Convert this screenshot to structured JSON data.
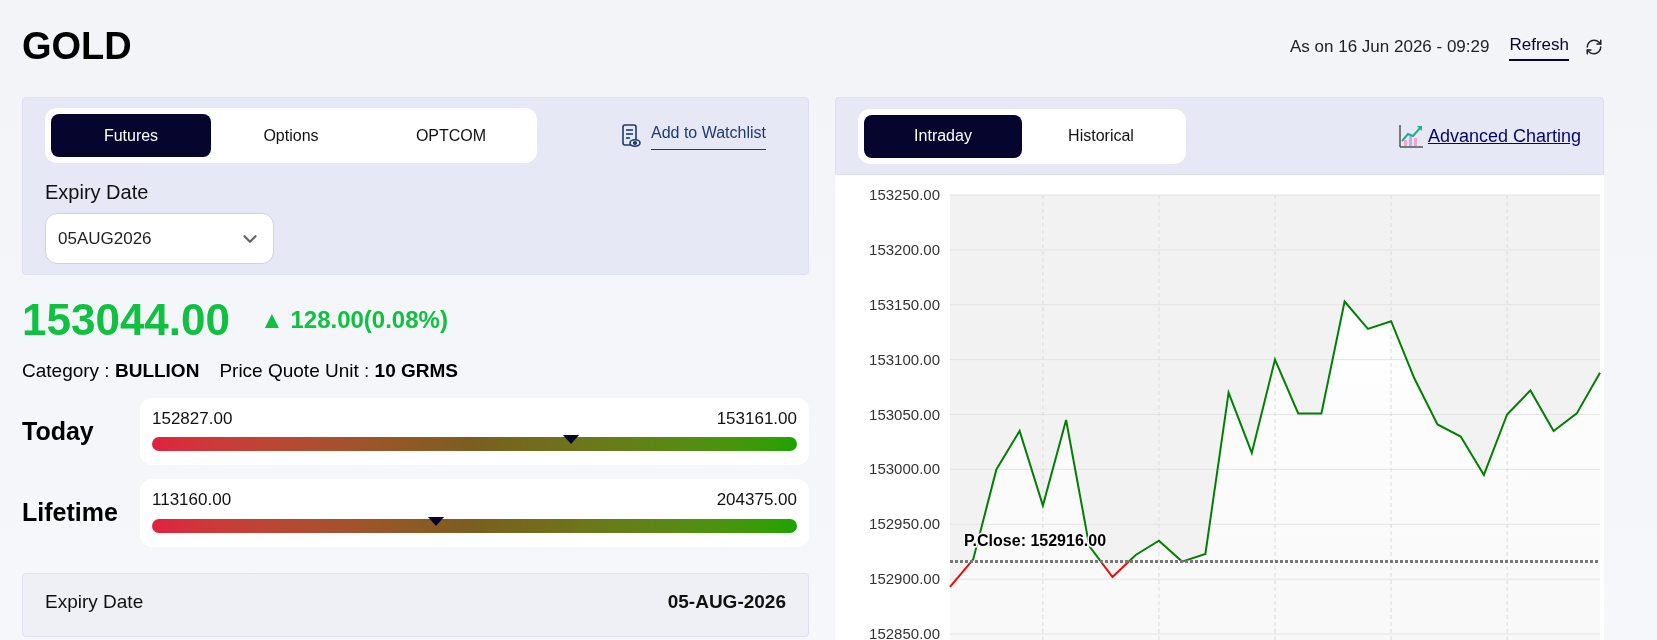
{
  "title": "GOLD",
  "header": {
    "as_on": "As on 16 Jun 2026 - 09:29",
    "refresh": "Refresh"
  },
  "left": {
    "tabs": [
      {
        "label": "Futures",
        "selected": true
      },
      {
        "label": "Options",
        "selected": false
      },
      {
        "label": "OPTCOM",
        "selected": false
      }
    ],
    "watchlist": "Add to Watchlist",
    "expiry_label": "Expiry Date",
    "expiry_value": "05AUG2026",
    "price": "153044.00",
    "arrow": "▲",
    "change": "128.00(0.08%)",
    "category_label": "Category :",
    "category_value": "BULLION",
    "unit_label": "Price Quote Unit :",
    "unit_value": "10 GRMS",
    "ranges": [
      {
        "label": "Today",
        "low": "152827.00",
        "high": "153161.00",
        "level": 0.65
      },
      {
        "label": "Lifetime",
        "low": "113160.00",
        "high": "204375.00",
        "level": 0.44
      }
    ],
    "details": [
      {
        "label": "Expiry Date",
        "value": "05-AUG-2026"
      }
    ]
  },
  "right": {
    "tabs": [
      {
        "label": "Intraday",
        "selected": true
      },
      {
        "label": "Historical",
        "selected": false
      }
    ],
    "advanced": "Advanced Charting",
    "chart_data": {
      "type": "area",
      "grid": true,
      "ylim": [
        152840,
        153250
      ],
      "yticks": [
        {
          "value": 152850,
          "label": "152850.00"
        },
        {
          "value": 152900,
          "label": "152900.00"
        },
        {
          "value": 152950,
          "label": "152950.00"
        },
        {
          "value": 153000,
          "label": "153000.00"
        },
        {
          "value": 153050,
          "label": "153050.00"
        },
        {
          "value": 153100,
          "label": "153100.00"
        },
        {
          "value": 153150,
          "label": "153150.00"
        },
        {
          "value": 153200,
          "label": "153200.00"
        },
        {
          "value": 153250,
          "label": "153250.00"
        }
      ],
      "series": [
        {
          "color": "#008000",
          "values": [
            152893,
            152918,
            153000,
            153035,
            152967,
            153045,
            152930,
            152902,
            152922,
            152935,
            152916,
            152923,
            153070,
            153015,
            153100,
            153051,
            153051,
            153153,
            153128,
            153135,
            153083,
            153041,
            153030,
            152995,
            153050,
            153072,
            153035,
            153051,
            153088
          ]
        },
        {
          "type": "line",
          "line_style": "dotted",
          "color": "#777777",
          "values": [
            152916,
            152916,
            152916,
            152916,
            152916,
            152916,
            152916,
            152916,
            152916,
            152916,
            152916,
            152916,
            152916,
            152916,
            152916,
            152916,
            152916,
            152916,
            152916,
            152916,
            152916,
            152916,
            152916,
            152916,
            152916,
            152916,
            152916,
            152916,
            152916
          ]
        }
      ]
    },
    "previous_close_label": "P.Close: 152916.00"
  }
}
